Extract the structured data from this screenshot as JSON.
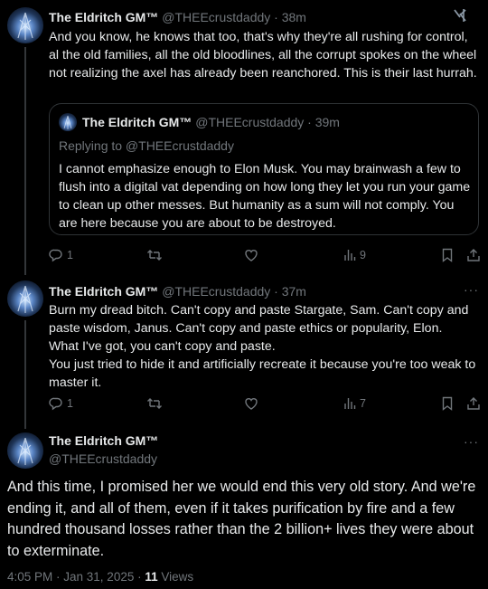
{
  "posts": [
    {
      "name": "The Eldritch GM™",
      "handle": "@THEEcrustdaddy",
      "time": "· 38m",
      "text": "And you know, he knows that too, that's why they're all rushing for control, al the old families, all the old bloodlines, all the corrupt spokes on the wheel not realizing the axel has already been reanchored. This is their last hurrah.",
      "grok_icon": "grok-icon",
      "quote": {
        "name": "The Eldritch GM™",
        "handle": "@THEEcrustdaddy",
        "time": "· 39m",
        "replying": "Replying to @THEEcrustdaddy",
        "text": "I cannot emphasize enough to Elon Musk. You may brainwash a few to flush into a digital vat depending on how long they let you run your game to clean up other messes. But humanity as a sum will not comply. You are here because you are about to be destroyed."
      },
      "replies": "1",
      "views": "9"
    },
    {
      "name": "The Eldritch GM™",
      "handle": "@THEEcrustdaddy",
      "time": "· 37m",
      "more": "···",
      "text": "Burn my dread bitch. Can't copy and paste Stargate, Sam. Can't copy and paste wisdom, Janus. Can't copy and paste ethics or popularity, Elon.\nWhat I've got, you can't copy and paste.\nYou just tried to hide it and artificially recreate it because you're too weak to master it.",
      "replies": "1",
      "views": "7"
    }
  ],
  "main_post": {
    "name": "The Eldritch GM™",
    "handle": "@THEEcrustdaddy",
    "more": "···",
    "text": "And this time, I promised her we would end this very old story. And we're ending it, and all of them, even if it takes purification by fire and a few hundred thousand losses rather than the 2 billion+ lives they were about to exterminate.",
    "timestamp": "4:05 PM · Jan 31, 2025 · ",
    "views_count": "11",
    "views_label": " Views"
  },
  "colors": {
    "background": "#000000",
    "text": "#e7e9ea",
    "muted": "#71767b",
    "border": "#2f3336"
  }
}
